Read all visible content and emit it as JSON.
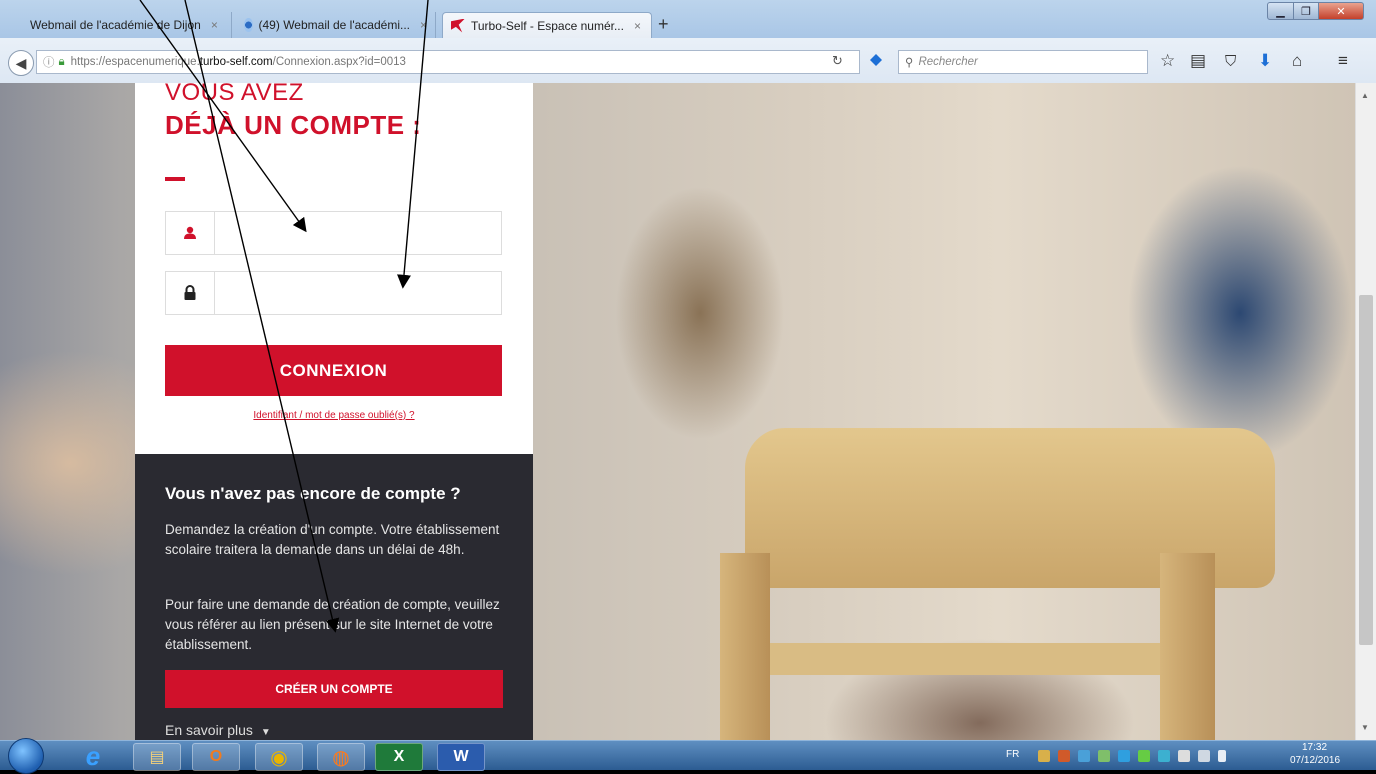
{
  "browser": {
    "tabs": [
      {
        "label": "Webmail de l'académie de Dijon",
        "active": false
      },
      {
        "label": "(49) Webmail de l'académi...",
        "active": false
      },
      {
        "label": "Turbo-Self - Espace numér...",
        "active": true
      }
    ],
    "tab_close": "×",
    "new_tab": "+",
    "url_prefix": "https://espacenumerique.",
    "url_host": "turbo-self.com",
    "url_path": "/Connexion.aspx?id=0013",
    "search_placeholder": "Rechercher",
    "window_buttons": {
      "minimize": "▁",
      "maximize": "❐",
      "close": "✕"
    }
  },
  "login": {
    "heading_line1": "VOUS AVEZ",
    "heading_line2": "DÉJÀ UN COMPTE :",
    "username_value": "",
    "password_value": "",
    "connexion_button": "CONNEXION",
    "forgot_link": "Identifiant / mot de passe oublié(s) ?"
  },
  "signup": {
    "title": "Vous n'avez pas encore de compte ?",
    "paragraph1": "Demandez la création d'un compte. Votre établissement scolaire traitera la demande dans un délai de 48h.",
    "paragraph2": "Pour faire une demande de création de compte, veuillez vous référer au lien présent sur le site Internet de votre établissement.",
    "create_button": "CRÉER UN COMPTE",
    "learn_more": "En savoir plus"
  },
  "taskbar": {
    "apps": [
      {
        "icon": "internet-explorer-icon",
        "glyph": "e"
      },
      {
        "icon": "file-explorer-icon",
        "glyph": "▤"
      },
      {
        "icon": "outlook-icon",
        "glyph": "O"
      },
      {
        "icon": "chrome-icon",
        "glyph": "◉"
      },
      {
        "icon": "firefox-icon",
        "glyph": "◍"
      },
      {
        "icon": "excel-icon",
        "glyph": "X"
      },
      {
        "icon": "word-icon",
        "glyph": "W"
      }
    ],
    "language": "FR",
    "time": "17:32",
    "date": "07/12/2016"
  },
  "colors": {
    "brand_red": "#d0112b",
    "dark_panel": "#2a2a31"
  }
}
